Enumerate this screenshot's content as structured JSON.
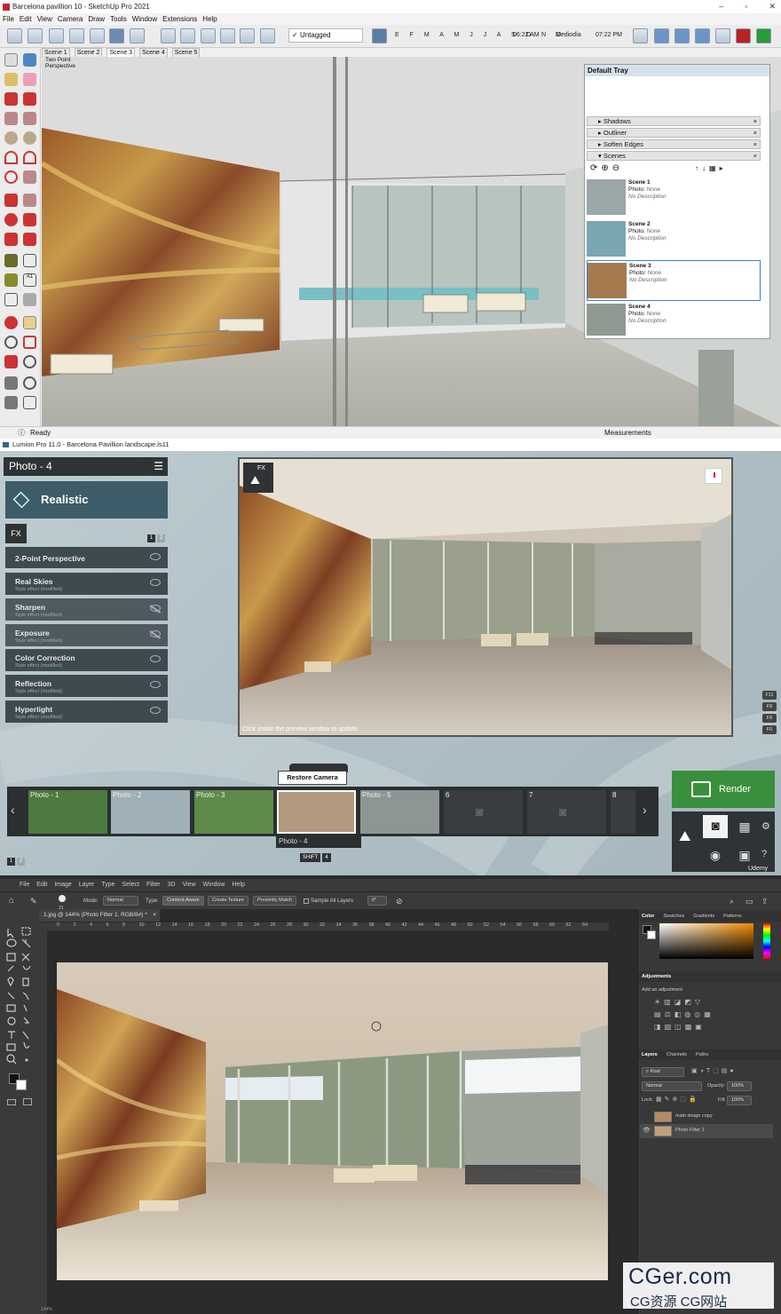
{
  "sketchup": {
    "title": "Barcelona pavillion 10 - SketchUp Pro 2021",
    "menu": [
      "File",
      "Edit",
      "View",
      "Camera",
      "Draw",
      "Tools",
      "Window",
      "Extensions",
      "Help"
    ],
    "tag": "Untagged",
    "months": "E F M A M J J A S O N D",
    "time_start": "06:22 AM",
    "time_mid": "Mediodía",
    "time_end": "07:22 PM",
    "scene_tabs": [
      "Scene 1",
      "Scene 2",
      "Scene 3",
      "Scene 4",
      "Scene 5"
    ],
    "active_scene_tab": "Scene 3",
    "view_label_1": "Two Point",
    "view_label_2": "Perspective",
    "status": "Ready",
    "measurements": "Measurements",
    "tray": {
      "title": "Default Tray",
      "sections": [
        "Shadows",
        "Outliner",
        "Soften Edges",
        "Scenes"
      ],
      "scenes": [
        {
          "name": "Scene 1",
          "photo": "Photo:",
          "photo_val": "None",
          "desc": "No Description"
        },
        {
          "name": "Scene 2",
          "photo": "Photo:",
          "photo_val": "None",
          "desc": "No Description"
        },
        {
          "name": "Scene 3",
          "photo": "Photo:",
          "photo_val": "None",
          "desc": "No Description"
        },
        {
          "name": "Scene 4",
          "photo": "Photo:",
          "photo_val": "None",
          "desc": "No Description"
        }
      ]
    }
  },
  "lumion": {
    "title": "Lumion Pro 11.0 - Barcelona Pavillion landscape.ls11",
    "photo_header": "Photo - 4",
    "style": "Realistic",
    "fx_label": "FX",
    "fx_pages": [
      "1",
      "2"
    ],
    "effects": [
      {
        "name": "2-Point Perspective",
        "sub": "",
        "visible": true
      },
      {
        "name": "Real Skies",
        "sub": "Style effect (modified)",
        "visible": true
      },
      {
        "name": "Sharpen",
        "sub": "Style effect (modified)",
        "visible": false
      },
      {
        "name": "Exposure",
        "sub": "Style effect (modified)",
        "visible": false
      },
      {
        "name": "Color Correction",
        "sub": "Style effect (modified)",
        "visible": true
      },
      {
        "name": "Reflection",
        "sub": "Style effect (modified)",
        "visible": true
      },
      {
        "name": "Hyperlight",
        "sub": "Style effect (modified)",
        "visible": true
      }
    ],
    "preview_caption": "Click inside the preview window to update.",
    "preview_fx": "FX",
    "side_keys": [
      "F11",
      "F8",
      "F9",
      "F0"
    ],
    "restore_camera": "Restore Camera",
    "thumbnails": [
      "Photo - 1",
      "Photo - 2",
      "Photo - 3",
      "Photo - 4",
      "Photo - 5",
      "6",
      "7",
      "8"
    ],
    "selected_photo": "Photo - 4",
    "shift_key": "SHIFT",
    "shift_num": "4",
    "render": "Render",
    "pages": [
      "1",
      "2"
    ],
    "watermark": "Udemy"
  },
  "photoshop": {
    "menu": [
      "File",
      "Edit",
      "Image",
      "Layer",
      "Type",
      "Select",
      "Filter",
      "3D",
      "View",
      "Window",
      "Help"
    ],
    "mode_label": "Mode:",
    "mode_value": "Normal",
    "type_label": "Type:",
    "type_options": [
      "Content-Aware",
      "Create Texture",
      "Proximity Match"
    ],
    "sample_all": "Sample All Layers",
    "angle": "0°",
    "brush_size": "31",
    "doc_tab": "1.jpg @ 144% (Photo Filter 1, RGB/8#) *",
    "ruler": [
      "0",
      "2",
      "4",
      "6",
      "8",
      "10",
      "12",
      "14",
      "16",
      "18",
      "20",
      "22",
      "24",
      "26",
      "28",
      "30",
      "32",
      "34",
      "36",
      "38",
      "40",
      "42",
      "44",
      "46",
      "48",
      "50",
      "52",
      "54",
      "56",
      "58",
      "60",
      "62",
      "64"
    ],
    "color_tabs": [
      "Color",
      "Swatches",
      "Gradients",
      "Patterns"
    ],
    "adjust_tab": "Adjustments",
    "adjust_hint": "Add an adjustment",
    "layer_tabs": [
      "Layers",
      "Channels",
      "Paths"
    ],
    "kind": "Kind",
    "blend": "Normal",
    "opacity_label": "Opacity:",
    "opacity": "100%",
    "lock_label": "Lock:",
    "fill_label": "Fill:",
    "fill": "100%",
    "layers": [
      "main image copy",
      "Photo Filter 1"
    ],
    "status": "144%"
  },
  "watermark": {
    "line1": "CGer.com",
    "line2": "CG资源 CG网站"
  },
  "colors": {
    "lumion_green": "#3a8f3c",
    "lumion_panel": "#3d5b68",
    "ps_blue": "#0a62c5",
    "tray_sel": "#3b7fd4"
  }
}
